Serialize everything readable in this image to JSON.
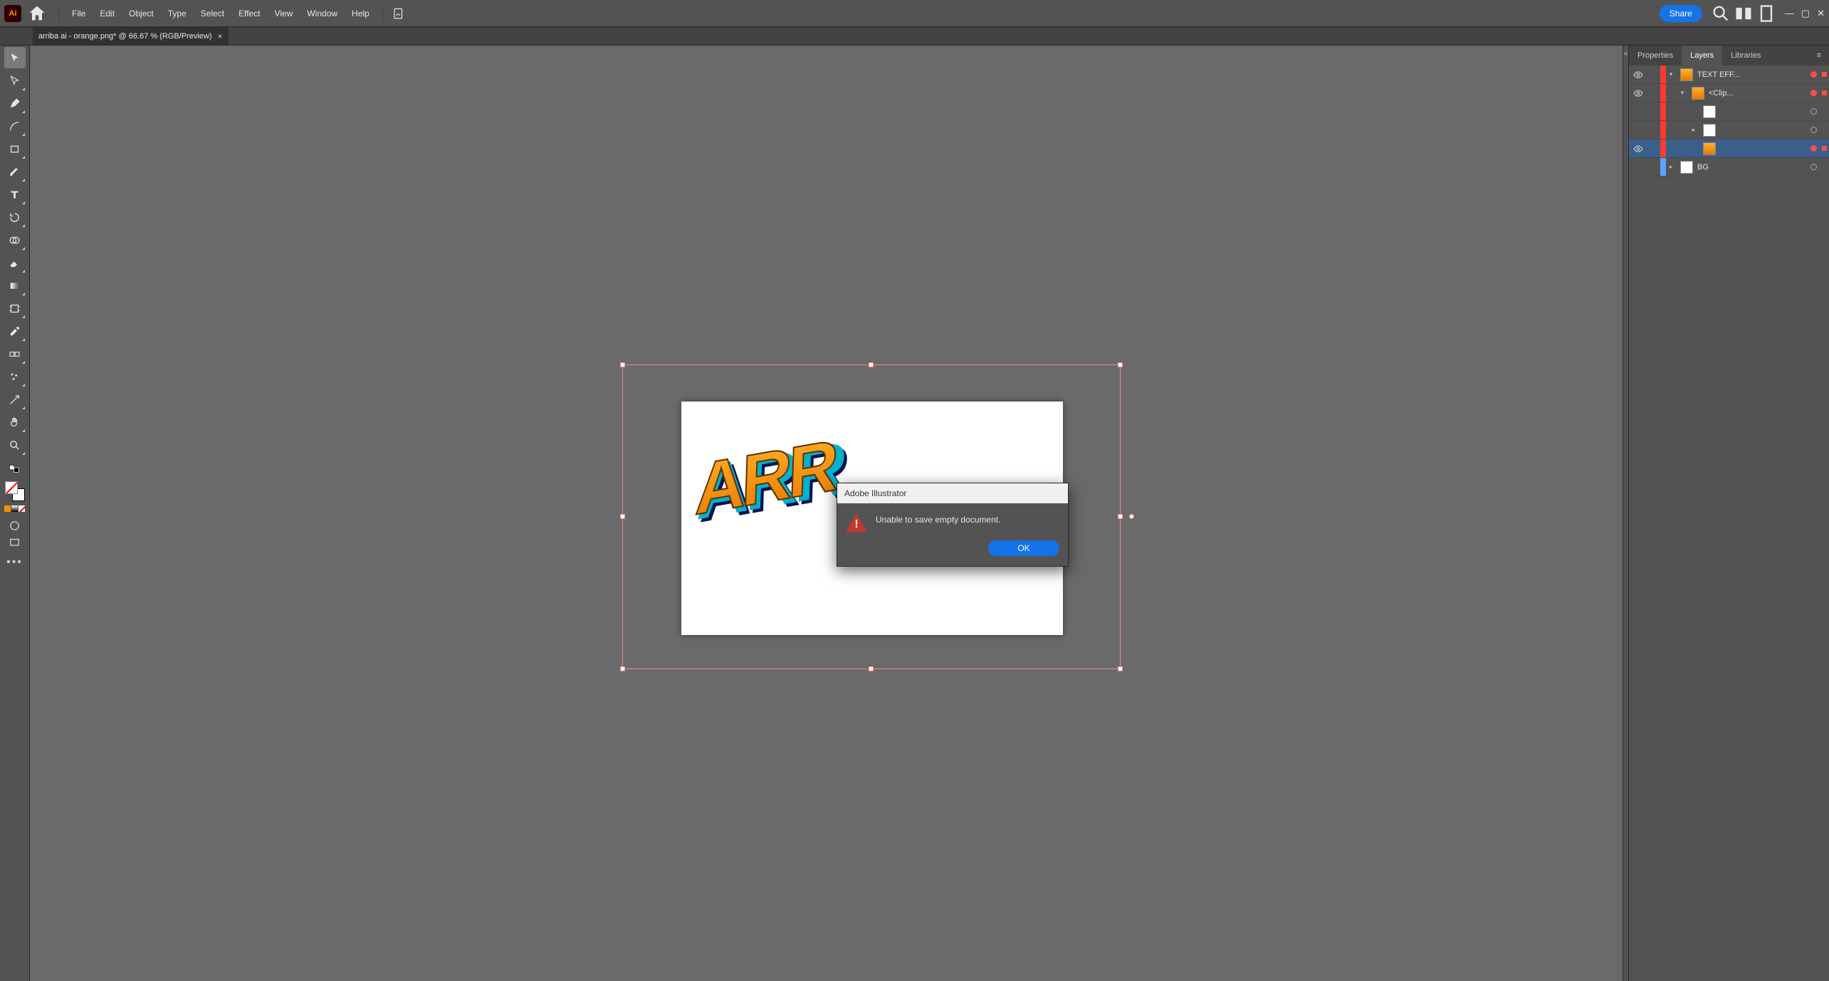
{
  "app": {
    "name": "Adobe Illustrator",
    "iconText": "Ai"
  },
  "menu": {
    "items": [
      "File",
      "Edit",
      "Object",
      "Type",
      "Select",
      "Effect",
      "View",
      "Window",
      "Help"
    ]
  },
  "header": {
    "shareLabel": "Share"
  },
  "tab": {
    "title": "arriba ai - orange.png* @ 66.67 % (RGB/Preview)"
  },
  "canvas": {
    "graffitiText": "ARR"
  },
  "dialog": {
    "title": "Adobe Illustrator",
    "message": "Unable to save empty document.",
    "okLabel": "OK"
  },
  "panels": {
    "tabs": {
      "properties": "Properties",
      "layers": "Layers",
      "libraries": "Libraries"
    },
    "layers": [
      {
        "eye": true,
        "color": "#ff3b30",
        "indent": 0,
        "twisty": "open",
        "thumb": "orange",
        "name": "TEXT EFF...",
        "target": true,
        "selected": true
      },
      {
        "eye": true,
        "color": "#ff3b30",
        "indent": 1,
        "twisty": "open",
        "thumb": "orange",
        "name": "<Clip...",
        "target": true,
        "selected": true
      },
      {
        "eye": false,
        "color": "#ff3b30",
        "indent": 2,
        "twisty": "",
        "thumb": "white",
        "name": "",
        "target": true,
        "selected": false
      },
      {
        "eye": false,
        "color": "#ff3b30",
        "indent": 2,
        "twisty": "closed",
        "thumb": "white",
        "name": "",
        "target": true,
        "selected": false
      },
      {
        "eye": true,
        "color": "#ff3b30",
        "indent": 2,
        "twisty": "",
        "thumb": "orange",
        "name": "",
        "target": true,
        "selected": true,
        "rowSel": true
      },
      {
        "eye": false,
        "color": "#58a6ff",
        "indent": 0,
        "twisty": "closed",
        "thumb": "white",
        "name": "BG",
        "target": false,
        "selected": false
      }
    ]
  },
  "tools": [
    "selection",
    "direct-selection",
    "pen",
    "curvature",
    "rectangle",
    "paintbrush",
    "type",
    "rotate",
    "shape-builder",
    "eraser",
    "gradient",
    "artboard",
    "eyedropper",
    "blend",
    "symbol-sprayer",
    "slice",
    "hand",
    "zoom"
  ]
}
